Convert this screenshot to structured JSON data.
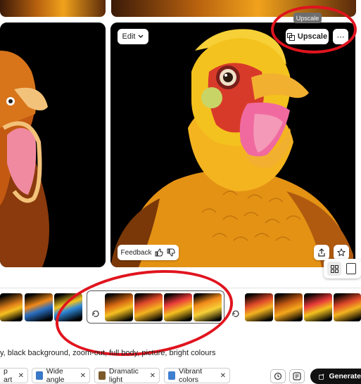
{
  "card": {
    "edit_label": "Edit",
    "upscale_label": "Upscale",
    "tooltip": "Upscale",
    "feedback_label": "Feedback"
  },
  "prompt": {
    "text": "y, black background, zoom-out, full body, picture, bright colours"
  },
  "chips": [
    {
      "label": "p art",
      "icon": "style-icon",
      "color": "#2c6fbd"
    },
    {
      "label": "Wide angle",
      "icon": "wide-angle-icon",
      "color": "#3a78c8"
    },
    {
      "label": "Dramatic light",
      "icon": "dramatic-light-icon",
      "color": "#7a5a2a"
    },
    {
      "label": "Vibrant colors",
      "icon": "vibrant-colors-icon",
      "color": "#3f7fd0"
    }
  ],
  "generate_label": "Generate",
  "colors": {
    "annotation": "#e0141e",
    "tooltip": "#6e6e6e",
    "generate_bg": "#111111",
    "bird_yellow": "#f6b21a",
    "bird_red": "#e0402a"
  }
}
